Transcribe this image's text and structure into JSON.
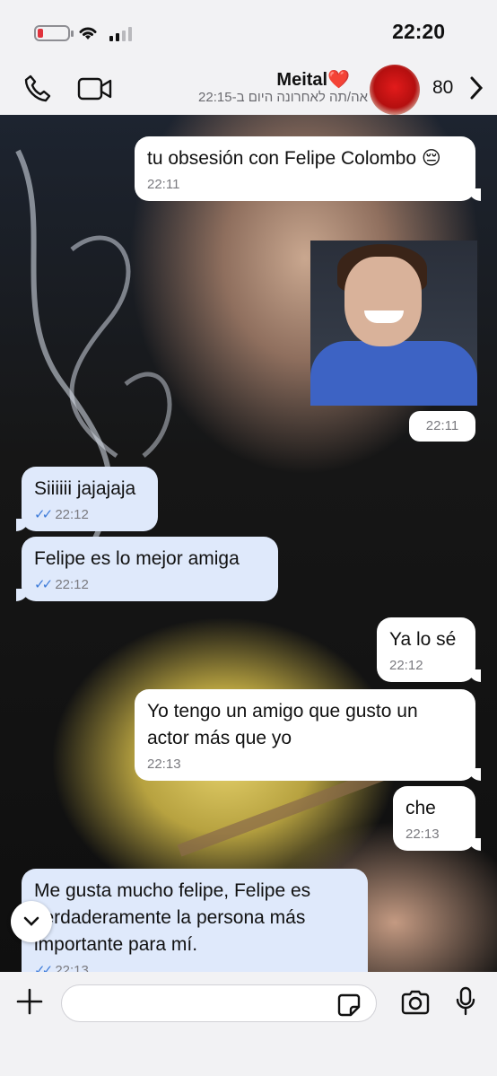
{
  "status_bar": {
    "time": "22:20",
    "battery_level": 0.2
  },
  "header": {
    "contact_name": "Meital❤️",
    "last_seen": "אה/תה לאחרונה היום ב-22:15",
    "unread_count": "80"
  },
  "messages": [
    {
      "direction": "out",
      "text": "tu obsesión con Felipe Colombo 😔",
      "time": "22:11"
    },
    {
      "direction": "out",
      "type": "photo",
      "time": "22:11"
    },
    {
      "direction": "in",
      "text": "Siiiiii jajajaja",
      "time": "22:12"
    },
    {
      "direction": "in",
      "text": "Felipe es lo mejor amiga",
      "time": "22:12"
    },
    {
      "direction": "out",
      "text": "Ya lo sé",
      "time": "22:12"
    },
    {
      "direction": "out",
      "text": "Yo tengo un amigo que gusto un actor más que yo",
      "time": "22:13"
    },
    {
      "direction": "out",
      "text": "che",
      "time": "22:13"
    },
    {
      "direction": "in",
      "text": "Me gusta mucho felipe, Felipe es verdaderamente la persona más importante para mí.",
      "time": "22:13"
    }
  ],
  "input": {
    "placeholder": "",
    "value": ""
  },
  "colors": {
    "incoming_bubble": "#dfe9fb",
    "outgoing_bubble": "#ffffff",
    "read_ticks": "#3d7bd9"
  }
}
